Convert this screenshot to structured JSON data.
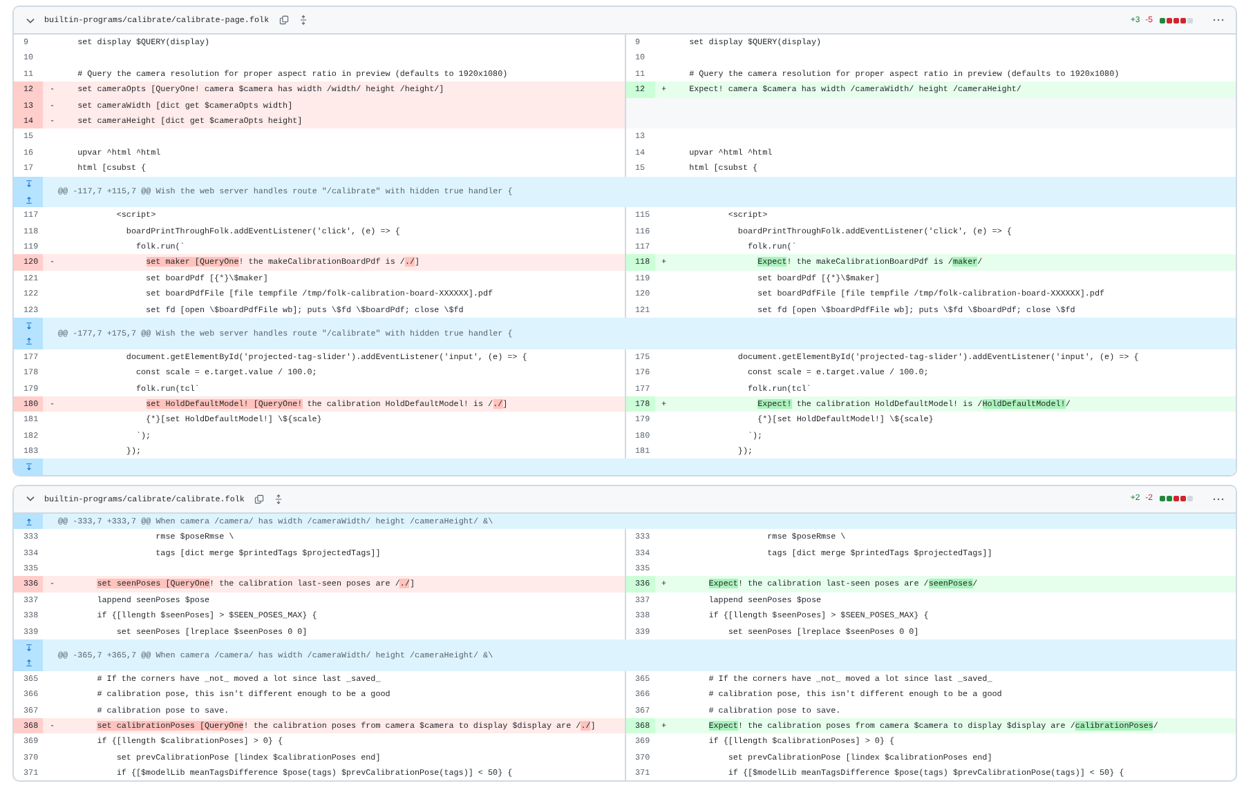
{
  "files": [
    {
      "path": "builtin-programs/calibrate/calibrate-page.folk",
      "expanded": true,
      "additions": "+3",
      "deletions": "-5",
      "diffstat": [
        {
          "kind": "added"
        },
        {
          "kind": "deleted"
        },
        {
          "kind": "deleted"
        },
        {
          "kind": "deleted"
        },
        {
          "kind": "neutral"
        }
      ],
      "rows": [
        {
          "kind": "line",
          "left": {
            "kind": "context",
            "num": "9",
            "text": "  set display $QUERY(display)"
          },
          "right": {
            "kind": "context",
            "num": "9",
            "text": "  set display $QUERY(display)"
          }
        },
        {
          "kind": "line",
          "left": {
            "kind": "context",
            "num": "10"
          },
          "right": {
            "kind": "context",
            "num": "10"
          }
        },
        {
          "kind": "line",
          "left": {
            "kind": "context",
            "num": "11",
            "text": "  # Query the camera resolution for proper aspect ratio in preview (defaults to 1920x1080)"
          },
          "right": {
            "kind": "context",
            "num": "11",
            "text": "  # Query the camera resolution for proper aspect ratio in preview (defaults to 1920x1080)"
          }
        },
        {
          "kind": "line",
          "left": {
            "kind": "deletion",
            "num": "12",
            "sign": "-",
            "text": "  set cameraOpts [QueryOne! camera $camera has width /width/ height /height/]"
          },
          "right": {
            "kind": "addition",
            "num": "12",
            "sign": "+",
            "text": "  Expect! camera $camera has width /cameraWidth/ height /cameraHeight/"
          }
        },
        {
          "kind": "line",
          "left": {
            "kind": "deletion",
            "num": "13",
            "sign": "-",
            "text": "  set cameraWidth [dict get $cameraOpts width]"
          },
          "right": {
            "kind": "empty"
          }
        },
        {
          "kind": "line",
          "left": {
            "kind": "deletion",
            "num": "14",
            "sign": "-",
            "text": "  set cameraHeight [dict get $cameraOpts height]"
          },
          "right": {
            "kind": "empty"
          }
        },
        {
          "kind": "line",
          "left": {
            "kind": "context",
            "num": "15"
          },
          "right": {
            "kind": "context",
            "num": "13"
          }
        },
        {
          "kind": "line",
          "left": {
            "kind": "context",
            "num": "16",
            "text": "  upvar ^html ^html"
          },
          "right": {
            "kind": "context",
            "num": "14",
            "text": "  upvar ^html ^html"
          }
        },
        {
          "kind": "line",
          "left": {
            "kind": "context",
            "num": "17",
            "text": "  html [csubst {"
          },
          "right": {
            "kind": "context",
            "num": "15",
            "text": "  html [csubst {"
          }
        },
        {
          "kind": "hunk",
          "header": "@@ -117,7 +115,7 @@ Wish the web server handles route \"/calibrate\" with hidden true handler {",
          "expand_down": true,
          "expand_up": true
        },
        {
          "kind": "line",
          "left": {
            "kind": "context",
            "num": "117",
            "text": "          <script>"
          },
          "right": {
            "kind": "context",
            "num": "115",
            "text": "          <script>"
          }
        },
        {
          "kind": "line",
          "left": {
            "kind": "context",
            "num": "118",
            "text": "            boardPrintThroughFolk.addEventListener('click', (e) => {"
          },
          "right": {
            "kind": "context",
            "num": "116",
            "text": "            boardPrintThroughFolk.addEventListener('click', (e) => {"
          }
        },
        {
          "kind": "line",
          "left": {
            "kind": "context",
            "num": "119",
            "text": "              folk.run(`"
          },
          "right": {
            "kind": "context",
            "num": "117",
            "text": "              folk.run(`"
          }
        },
        {
          "kind": "line",
          "left": {
            "kind": "deletion",
            "num": "120",
            "sign": "-",
            "parts": [
              {
                "text": "                set maker [QueryOne",
                "changed": true
              },
              {
                "text": "! the makeCalibrationBoardPdf is /",
                "changed": false
              },
              {
                "text": "./",
                "changed": true
              },
              {
                "text": "]",
                "changed": false
              }
            ]
          },
          "right": {
            "kind": "addition",
            "num": "118",
            "sign": "+",
            "parts": [
              {
                "text": "                Expect",
                "changed": true
              },
              {
                "text": "! the makeCalibrationBoardPdf is /",
                "changed": false
              },
              {
                "text": "maker",
                "changed": true
              },
              {
                "text": "/",
                "changed": false
              }
            ]
          }
        },
        {
          "kind": "line",
          "left": {
            "kind": "context",
            "num": "121",
            "text": "                set boardPdf [{*}\\$maker]"
          },
          "right": {
            "kind": "context",
            "num": "119",
            "text": "                set boardPdf [{*}\\$maker]"
          }
        },
        {
          "kind": "line",
          "left": {
            "kind": "context",
            "num": "122",
            "text": "                set boardPdfFile [file tempfile /tmp/folk-calibration-board-XXXXXX].pdf"
          },
          "right": {
            "kind": "context",
            "num": "120",
            "text": "                set boardPdfFile [file tempfile /tmp/folk-calibration-board-XXXXXX].pdf"
          }
        },
        {
          "kind": "line",
          "left": {
            "kind": "context",
            "num": "123",
            "text": "                set fd [open \\$boardPdfFile wb]; puts \\$fd \\$boardPdf; close \\$fd"
          },
          "right": {
            "kind": "context",
            "num": "121",
            "text": "                set fd [open \\$boardPdfFile wb]; puts \\$fd \\$boardPdf; close \\$fd"
          }
        },
        {
          "kind": "hunk",
          "header": "@@ -177,7 +175,7 @@ Wish the web server handles route \"/calibrate\" with hidden true handler {",
          "expand_down": true,
          "expand_up": true
        },
        {
          "kind": "line",
          "left": {
            "kind": "context",
            "num": "177",
            "text": "            document.getElementById('projected-tag-slider').addEventListener('input', (e) => {"
          },
          "right": {
            "kind": "context",
            "num": "175",
            "text": "            document.getElementById('projected-tag-slider').addEventListener('input', (e) => {"
          }
        },
        {
          "kind": "line",
          "left": {
            "kind": "context",
            "num": "178",
            "text": "              const scale = e.target.value / 100.0;"
          },
          "right": {
            "kind": "context",
            "num": "176",
            "text": "              const scale = e.target.value / 100.0;"
          }
        },
        {
          "kind": "line",
          "left": {
            "kind": "context",
            "num": "179",
            "text": "              folk.run(tcl`"
          },
          "right": {
            "kind": "context",
            "num": "177",
            "text": "              folk.run(tcl`"
          }
        },
        {
          "kind": "line",
          "left": {
            "kind": "deletion",
            "num": "180",
            "sign": "-",
            "parts": [
              {
                "text": "                set HoldDefaultModel! [QueryOne!",
                "changed": true
              },
              {
                "text": " the calibration HoldDefaultModel! is /",
                "changed": false
              },
              {
                "text": "./",
                "changed": true
              },
              {
                "text": "]",
                "changed": false
              }
            ]
          },
          "right": {
            "kind": "addition",
            "num": "178",
            "sign": "+",
            "parts": [
              {
                "text": "                Expect!",
                "changed": true
              },
              {
                "text": " the calibration HoldDefaultModel! is /",
                "changed": false
              },
              {
                "text": "HoldDefaultModel!",
                "changed": true
              },
              {
                "text": "/",
                "changed": false
              }
            ]
          }
        },
        {
          "kind": "line",
          "left": {
            "kind": "context",
            "num": "181",
            "text": "                {*}[set HoldDefaultModel!] \\${scale}"
          },
          "right": {
            "kind": "context",
            "num": "179",
            "text": "                {*}[set HoldDefaultModel!] \\${scale}"
          }
        },
        {
          "kind": "line",
          "left": {
            "kind": "context",
            "num": "182",
            "text": "              `);"
          },
          "right": {
            "kind": "context",
            "num": "180",
            "text": "              `);"
          }
        },
        {
          "kind": "line",
          "left": {
            "kind": "context",
            "num": "183",
            "text": "            });"
          },
          "right": {
            "kind": "context",
            "num": "181",
            "text": "            });"
          }
        },
        {
          "kind": "hunk",
          "expand_down": true
        }
      ]
    },
    {
      "path": "builtin-programs/calibrate/calibrate.folk",
      "expanded": true,
      "additions": "+2",
      "deletions": "-2",
      "diffstat": [
        {
          "kind": "added"
        },
        {
          "kind": "added"
        },
        {
          "kind": "deleted"
        },
        {
          "kind": "deleted"
        },
        {
          "kind": "neutral"
        }
      ],
      "rows": [
        {
          "kind": "hunk",
          "header": "@@ -333,7 +333,7 @@ When camera /camera/ has width /cameraWidth/ height /cameraHeight/ &\\",
          "expand_up": true
        },
        {
          "kind": "line",
          "left": {
            "kind": "context",
            "num": "333",
            "text": "                  rmse $poseRmse \\"
          },
          "right": {
            "kind": "context",
            "num": "333",
            "text": "                  rmse $poseRmse \\"
          }
        },
        {
          "kind": "line",
          "left": {
            "kind": "context",
            "num": "334",
            "text": "                  tags [dict merge $printedTags $projectedTags]]"
          },
          "right": {
            "kind": "context",
            "num": "334",
            "text": "                  tags [dict merge $printedTags $projectedTags]]"
          }
        },
        {
          "kind": "line",
          "left": {
            "kind": "context",
            "num": "335"
          },
          "right": {
            "kind": "context",
            "num": "335"
          }
        },
        {
          "kind": "line",
          "left": {
            "kind": "deletion",
            "num": "336",
            "sign": "-",
            "parts": [
              {
                "text": "      set seenPoses [QueryOne",
                "changed": true
              },
              {
                "text": "! the calibration last-seen poses are /",
                "changed": false
              },
              {
                "text": "./",
                "changed": true
              },
              {
                "text": "]",
                "changed": false
              }
            ]
          },
          "right": {
            "kind": "addition",
            "num": "336",
            "sign": "+",
            "parts": [
              {
                "text": "      Expect",
                "changed": true
              },
              {
                "text": "! the calibration last-seen poses are /",
                "changed": false
              },
              {
                "text": "seenPoses",
                "changed": true
              },
              {
                "text": "/",
                "changed": false
              }
            ]
          }
        },
        {
          "kind": "line",
          "left": {
            "kind": "context",
            "num": "337",
            "text": "      lappend seenPoses $pose"
          },
          "right": {
            "kind": "context",
            "num": "337",
            "text": "      lappend seenPoses $pose"
          }
        },
        {
          "kind": "line",
          "left": {
            "kind": "context",
            "num": "338",
            "text": "      if {[llength $seenPoses] > $SEEN_POSES_MAX} {"
          },
          "right": {
            "kind": "context",
            "num": "338",
            "text": "      if {[llength $seenPoses] > $SEEN_POSES_MAX} {"
          }
        },
        {
          "kind": "line",
          "left": {
            "kind": "context",
            "num": "339",
            "text": "          set seenPoses [lreplace $seenPoses 0 0]"
          },
          "right": {
            "kind": "context",
            "num": "339",
            "text": "          set seenPoses [lreplace $seenPoses 0 0]"
          }
        },
        {
          "kind": "hunk",
          "header": "@@ -365,7 +365,7 @@ When camera /camera/ has width /cameraWidth/ height /cameraHeight/ &\\",
          "expand_down": true,
          "expand_up": true
        },
        {
          "kind": "line",
          "left": {
            "kind": "context",
            "num": "365",
            "text": "      # If the corners have _not_ moved a lot since last _saved_"
          },
          "right": {
            "kind": "context",
            "num": "365",
            "text": "      # If the corners have _not_ moved a lot since last _saved_"
          }
        },
        {
          "kind": "line",
          "left": {
            "kind": "context",
            "num": "366",
            "text": "      # calibration pose, this isn't different enough to be a good"
          },
          "right": {
            "kind": "context",
            "num": "366",
            "text": "      # calibration pose, this isn't different enough to be a good"
          }
        },
        {
          "kind": "line",
          "left": {
            "kind": "context",
            "num": "367",
            "text": "      # calibration pose to save."
          },
          "right": {
            "kind": "context",
            "num": "367",
            "text": "      # calibration pose to save."
          }
        },
        {
          "kind": "line",
          "left": {
            "kind": "deletion",
            "num": "368",
            "sign": "-",
            "parts": [
              {
                "text": "      set calibrationPoses [QueryOne",
                "changed": true
              },
              {
                "text": "! the calibration poses from camera $camera to display $display are /",
                "changed": false
              },
              {
                "text": "./",
                "changed": true
              },
              {
                "text": "]",
                "changed": false
              }
            ]
          },
          "right": {
            "kind": "addition",
            "num": "368",
            "sign": "+",
            "parts": [
              {
                "text": "      Expect",
                "changed": true
              },
              {
                "text": "! the calibration poses from camera $camera to display $display are /",
                "changed": false
              },
              {
                "text": "calibrationPoses",
                "changed": true
              },
              {
                "text": "/",
                "changed": false
              }
            ]
          }
        },
        {
          "kind": "line",
          "left": {
            "kind": "context",
            "num": "369",
            "text": "      if {[llength $calibrationPoses] > 0} {"
          },
          "right": {
            "kind": "context",
            "num": "369",
            "text": "      if {[llength $calibrationPoses] > 0} {"
          }
        },
        {
          "kind": "line",
          "left": {
            "kind": "context",
            "num": "370",
            "text": "          set prevCalibrationPose [lindex $calibrationPoses end]"
          },
          "right": {
            "kind": "context",
            "num": "370",
            "text": "          set prevCalibrationPose [lindex $calibrationPoses end]"
          }
        },
        {
          "kind": "line",
          "left": {
            "kind": "context",
            "num": "371",
            "text": "          if {[$modelLib meanTagsDifference $pose(tags) $prevCalibrationPose(tags)] < 50} {"
          },
          "right": {
            "kind": "context",
            "num": "371",
            "text": "          if {[$modelLib meanTagsDifference $pose(tags) $prevCalibrationPose(tags)] < 50} {"
          }
        }
      ]
    }
  ]
}
